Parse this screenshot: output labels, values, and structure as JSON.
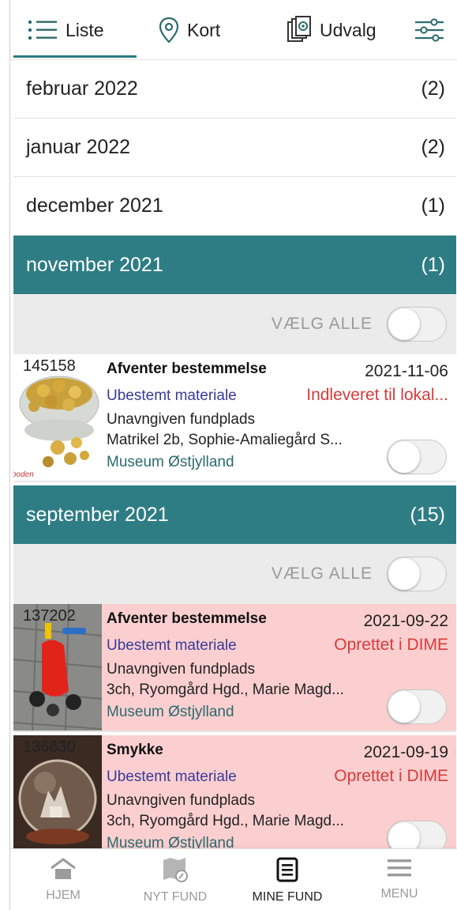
{
  "tabs": [
    {
      "label": "Liste",
      "icon": "list-icon",
      "active": true
    },
    {
      "label": "Kort",
      "icon": "map-pin-icon"
    },
    {
      "label": "Udvalg",
      "icon": "documents-icon"
    }
  ],
  "filter_icon": "sliders-icon",
  "months": [
    {
      "label": "februar 2022",
      "count": "(2)"
    },
    {
      "label": "januar 2022",
      "count": "(2)"
    },
    {
      "label": "december 2021",
      "count": "(1)"
    },
    {
      "label": "november 2021",
      "count": "(1)",
      "active": true
    },
    {
      "label": "september 2021",
      "count": "(15)",
      "active": true
    }
  ],
  "select_all_label": "VÆLG ALLE",
  "finds": [
    {
      "id": "145158",
      "title": "Afventer bestemmelse",
      "date": "2021-11-06",
      "material": "Ubestemt materiale",
      "status": "Indleveret til lokal...",
      "place": "Unavngiven fundplads",
      "address": "Matrikel 2b, Sophie-Amaliegård S...",
      "museum": "Museum Østjylland",
      "thumb_caption": "boden",
      "highlight": false
    },
    {
      "id": "137202",
      "title": "Afventer bestemmelse",
      "date": "2021-09-22",
      "material": "Ubestemt materiale",
      "status": "Oprettet i DIME",
      "place": "Unavngiven fundplads",
      "address": "3ch, Ryomgård Hgd., Marie Magd...",
      "museum": "Museum Østjylland",
      "highlight": true
    },
    {
      "id": "136630",
      "title": "Smykke",
      "date": "2021-09-19",
      "material": "Ubestemt materiale",
      "status": "Oprettet i DIME",
      "place": "Unavngiven fundplads",
      "address": "3ch, Ryomgård Hgd., Marie Magd...",
      "museum": "Museum Østjylland",
      "highlight": true
    }
  ],
  "bottom_nav": [
    {
      "label": "HJEM",
      "icon": "home-icon"
    },
    {
      "label": "NYT FUND",
      "icon": "new-find-map-icon"
    },
    {
      "label": "MINE FUND",
      "icon": "document-list-icon",
      "active": true
    },
    {
      "label": "MENU",
      "icon": "hamburger-menu-icon"
    }
  ],
  "colors": {
    "accent": "#2e7d84",
    "pink_row": "#fbcfcf",
    "status_red": "#d93a3a",
    "material_blue": "#3a3a9a",
    "museum_teal": "#2b6b6f"
  }
}
